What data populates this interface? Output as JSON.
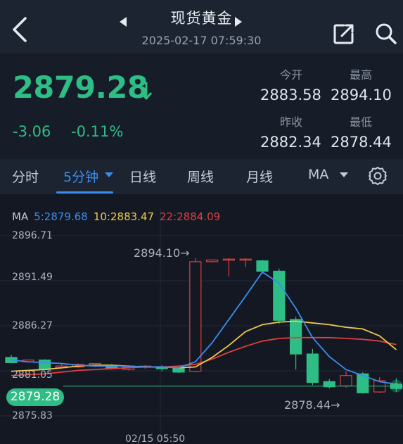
{
  "header": {
    "title": "现货黄金",
    "datetime": "2025-02-17 07:59:30",
    "icons": [
      "back-icon",
      "prev-triangle-icon",
      "next-triangle-icon",
      "share-icon",
      "search-icon"
    ]
  },
  "quote": {
    "price": "2879.28",
    "change": "-3.06",
    "change_pct": "-0.11%",
    "direction_icon": "down-arrow-icon",
    "color_down": "#2ebd85",
    "stats": {
      "open_label": "今开",
      "open": "2883.58",
      "high_label": "最高",
      "high": "2894.10",
      "prev_close_label": "昨收",
      "prev_close": "2882.34",
      "low_label": "最低",
      "low": "2878.44"
    }
  },
  "tabs": {
    "items": [
      "分时",
      "5分钟",
      "日线",
      "周线",
      "月线",
      "MA"
    ],
    "active": "5分钟",
    "accent": "#3b8cf0"
  },
  "chart_data": {
    "type": "candlestick",
    "interval": "5分钟",
    "ma_title": "MA",
    "ma_labels": {
      "ma5": "5:2879.68",
      "ma10": "10:2883.47",
      "ma22": "22:2884.09"
    },
    "ma_colors": {
      "ma5": "#3b8cf0",
      "ma10": "#f2c94c",
      "ma22": "#e0403d"
    },
    "y_ticks": [
      "2896.71",
      "2891.49",
      "2886.27",
      "2881.05",
      "2875.83"
    ],
    "ylim": [
      2875.83,
      2896.71
    ],
    "x_label": "02/15 05:50",
    "current_price_label": "2879.28",
    "high_annotation": "2894.10→",
    "low_annotation": "2878.44→",
    "up_color": "#e0403d",
    "down_color": "#2ebd85",
    "candles": [
      {
        "o": 2882.6,
        "h": 2882.9,
        "c": 2882.0,
        "l": 2882.0
      },
      {
        "o": 2882.1,
        "h": 2882.3,
        "c": 2882.3,
        "l": 2882.0
      },
      {
        "o": 2882.3,
        "h": 2882.4,
        "c": 2881.2,
        "l": 2881.1
      },
      {
        "o": 2881.4,
        "h": 2881.8,
        "c": 2881.6,
        "l": 2881.3
      },
      {
        "o": 2881.5,
        "h": 2881.9,
        "c": 2881.8,
        "l": 2881.4
      },
      {
        "o": 2881.7,
        "h": 2881.9,
        "c": 2881.9,
        "l": 2881.5
      },
      {
        "o": 2881.6,
        "h": 2881.8,
        "c": 2881.3,
        "l": 2881.2
      },
      {
        "o": 2881.2,
        "h": 2881.7,
        "c": 2881.5,
        "l": 2881.1
      },
      {
        "o": 2881.5,
        "h": 2881.7,
        "c": 2881.6,
        "l": 2881.3
      },
      {
        "o": 2881.5,
        "h": 2881.7,
        "c": 2881.3,
        "l": 2881.0
      },
      {
        "o": 2881.4,
        "h": 2881.6,
        "c": 2880.9,
        "l": 2880.8
      },
      {
        "o": 2881.0,
        "h": 2894.1,
        "c": 2893.7,
        "l": 2880.9
      },
      {
        "o": 2893.7,
        "h": 2893.9,
        "c": 2893.9,
        "l": 2893.6
      },
      {
        "o": 2893.9,
        "h": 2894.1,
        "c": 2894.0,
        "l": 2892.0
      },
      {
        "o": 2894.0,
        "h": 2894.1,
        "c": 2894.0,
        "l": 2893.1
      },
      {
        "o": 2893.8,
        "h": 2893.9,
        "c": 2892.6,
        "l": 2892.3
      },
      {
        "o": 2892.6,
        "h": 2892.9,
        "c": 2886.9,
        "l": 2886.5
      },
      {
        "o": 2887.0,
        "h": 2887.3,
        "c": 2883.0,
        "l": 2881.2
      },
      {
        "o": 2883.0,
        "h": 2883.6,
        "c": 2879.7,
        "l": 2879.4
      },
      {
        "o": 2879.8,
        "h": 2880.1,
        "c": 2879.2,
        "l": 2879.0
      },
      {
        "o": 2879.3,
        "h": 2881.0,
        "c": 2880.5,
        "l": 2879.1
      },
      {
        "o": 2880.7,
        "h": 2880.9,
        "c": 2878.5,
        "l": 2878.4
      },
      {
        "o": 2878.6,
        "h": 2880.3,
        "c": 2879.9,
        "l": 2878.5
      },
      {
        "o": 2879.5,
        "h": 2880.2,
        "c": 2879.0,
        "l": 2878.6
      }
    ],
    "ma5": [
      2882.3,
      2882.1,
      2882.0,
      2881.9,
      2881.7,
      2881.6,
      2881.6,
      2881.6,
      2881.5,
      2881.5,
      2881.4,
      2882.1,
      2884.3,
      2887.0,
      2889.7,
      2892.5,
      2891.2,
      2888.3,
      2884.9,
      2882.7,
      2881.2,
      2880.5,
      2879.8,
      2879.5
    ],
    "ma10": [
      2881.0,
      2881.1,
      2881.2,
      2881.4,
      2881.6,
      2881.7,
      2881.7,
      2881.6,
      2881.5,
      2881.5,
      2881.4,
      2881.5,
      2882.6,
      2884.0,
      2885.6,
      2886.4,
      2886.7,
      2886.8,
      2886.6,
      2886.4,
      2886.1,
      2885.9,
      2885.1,
      2883.5
    ],
    "ma22": [
      2880.5,
      2880.6,
      2880.7,
      2880.9,
      2881.1,
      2881.2,
      2881.3,
      2881.4,
      2881.5,
      2881.5,
      2881.6,
      2881.8,
      2882.4,
      2883.2,
      2883.9,
      2884.5,
      2884.8,
      2884.9,
      2884.9,
      2884.9,
      2884.8,
      2884.7,
      2884.5,
      2884.1
    ]
  }
}
